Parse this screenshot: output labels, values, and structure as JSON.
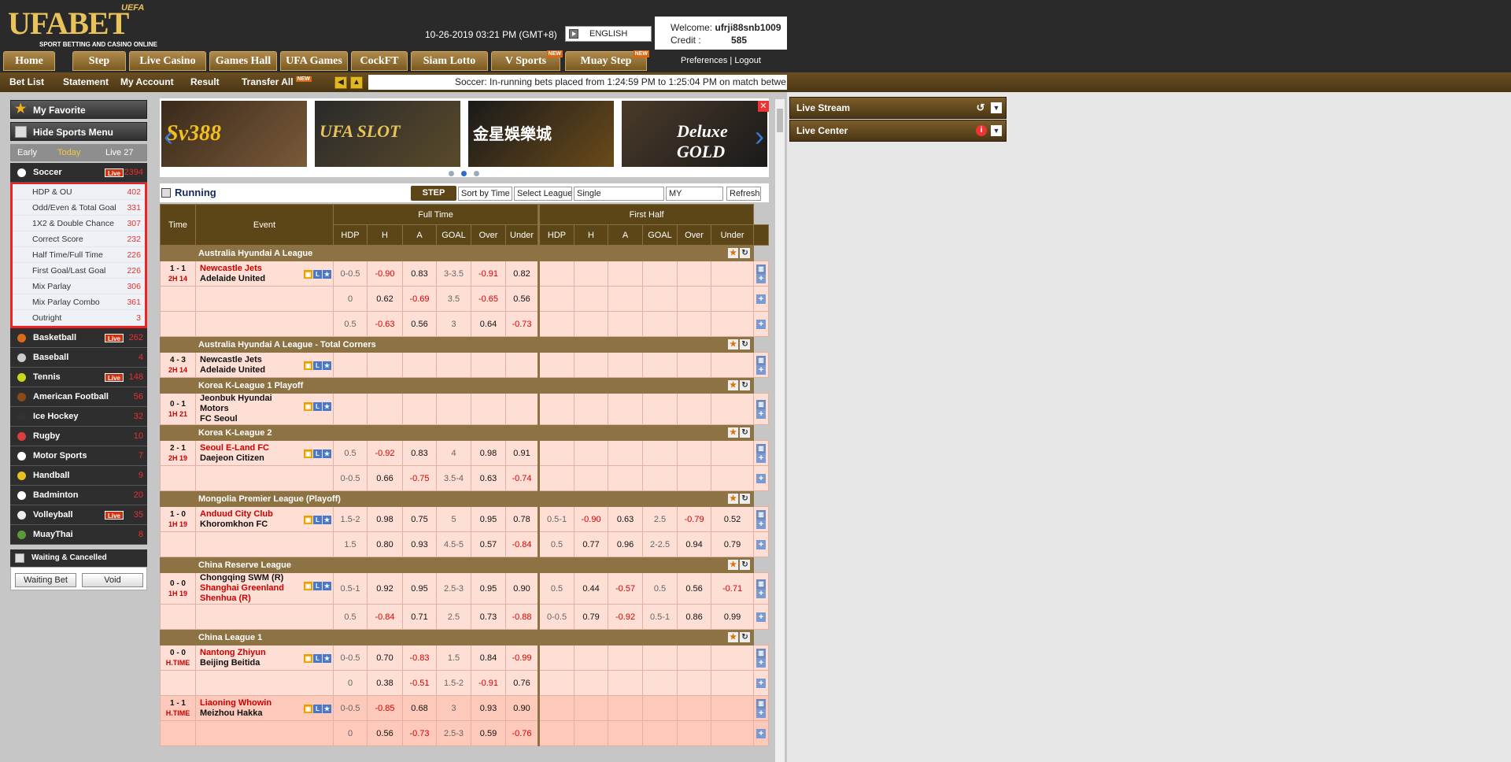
{
  "header": {
    "logo_uefa": "UEFA",
    "logo_main": "UFABET",
    "logo_sub": "SPORT BETTING AND CASINO ONLINE",
    "datetime": "10-26-2019 03:21 PM (GMT+8)",
    "language": "ENGLISH",
    "welcome_label": "Welcome:",
    "username": "ufrji88snb1009",
    "credit_label": "Credit :",
    "credit_value": "585",
    "preferences": "Preferences",
    "separator": "|",
    "logout": "Logout"
  },
  "topnav": [
    "Home",
    "Step",
    "Live Casino",
    "Games Hall",
    "UFA Games",
    "CockFT",
    "Siam Lotto",
    "V Sports",
    "Muay Step"
  ],
  "new_tag": "NEW",
  "subnav": {
    "items": [
      "Bet List",
      "Statement",
      "My Account",
      "Result",
      "Transfer All"
    ],
    "ticker": "Soccer: In-running bets placed from 1:24:59 PM to 1:25:04 PM on match betwe"
  },
  "sidebar": {
    "favorite": "My Favorite",
    "hide_menu": "Hide Sports Menu",
    "tabs": [
      "Early",
      "Today",
      "Live 27"
    ],
    "soccer": {
      "name": "Soccer",
      "live": "Live",
      "count": "2394"
    },
    "submenu": [
      {
        "label": "HDP & OU",
        "count": "402"
      },
      {
        "label": "Odd/Even & Total Goal",
        "count": "331"
      },
      {
        "label": "1X2 & Double Chance",
        "count": "307"
      },
      {
        "label": "Correct Score",
        "count": "232"
      },
      {
        "label": "Half Time/Full Time",
        "count": "226"
      },
      {
        "label": "First Goal/Last Goal",
        "count": "226"
      },
      {
        "label": "Mix Parlay",
        "count": "306"
      },
      {
        "label": "Mix Parlay Combo",
        "count": "361"
      },
      {
        "label": "Outright",
        "count": "3"
      }
    ],
    "sports": [
      {
        "name": "Basketball",
        "live": "Live",
        "count": "262",
        "color": "#d86b1a"
      },
      {
        "name": "Baseball",
        "live": "",
        "count": "4",
        "color": "#cccccc"
      },
      {
        "name": "Tennis",
        "live": "Live",
        "count": "148",
        "color": "#c8d820"
      },
      {
        "name": "American Football",
        "live": "",
        "count": "56",
        "color": "#8b4a1a"
      },
      {
        "name": "Ice Hockey",
        "live": "",
        "count": "32",
        "color": "#333333"
      },
      {
        "name": "Rugby",
        "live": "",
        "count": "10",
        "color": "#d84040"
      },
      {
        "name": "Motor Sports",
        "live": "",
        "count": "7",
        "color": "#ffffff"
      },
      {
        "name": "Handball",
        "live": "",
        "count": "9",
        "color": "#e8c020"
      },
      {
        "name": "Badminton",
        "live": "",
        "count": "20",
        "color": "#ffffff"
      },
      {
        "name": "Volleyball",
        "live": "Live",
        "count": "35",
        "color": "#eeeeee"
      },
      {
        "name": "MuayThai",
        "live": "",
        "count": "8",
        "color": "#5a9a3a"
      }
    ],
    "waiting": "Waiting & Cancelled",
    "waiting_bet": "Waiting Bet",
    "void": "Void"
  },
  "banners": [
    "Sv388",
    "UFA SLOT",
    "金星娛樂城",
    "Deluxe GOLD"
  ],
  "running": {
    "title": "Running",
    "step": "STEP",
    "sort": "Sort by Time",
    "league": "Select League",
    "type": "Single",
    "odds": "MY",
    "refresh": "Refresh"
  },
  "table": {
    "time": "Time",
    "event": "Event",
    "full_time": "Full Time",
    "first_half": "First Half",
    "cols": [
      "HDP",
      "H",
      "A",
      "GOAL",
      "Over",
      "Under"
    ],
    "rows": [
      {
        "type": "league",
        "name": "Australia Hyundai A League"
      },
      {
        "type": "match",
        "score": "1 - 1",
        "tm": "2H 14",
        "home": "Newcastle Jets",
        "away": "Adelaide United",
        "homeRed": true,
        "ft": [
          "0-0.5",
          "-0.90",
          "0.83",
          "3-3.5",
          "-0.91",
          "0.82"
        ],
        "fh": [
          "",
          "",
          "",
          "",
          "",
          ""
        ]
      },
      {
        "type": "sub",
        "ft": [
          "0",
          "0.62",
          "-0.69",
          "3.5",
          "-0.65",
          "0.56"
        ],
        "fh": [
          "",
          "",
          "",
          "",
          "",
          ""
        ]
      },
      {
        "type": "sub",
        "ft": [
          "0.5",
          "-0.63",
          "0.56",
          "3",
          "0.64",
          "-0.73"
        ],
        "fh": [
          "",
          "",
          "",
          "",
          "",
          ""
        ]
      },
      {
        "type": "league",
        "name": "Australia Hyundai A League - Total Corners"
      },
      {
        "type": "match",
        "score": "4 - 3",
        "tm": "2H 14",
        "home": "Newcastle Jets",
        "away": "Adelaide United",
        "homeRed": false,
        "ft": [
          "",
          "",
          "",
          "",
          "",
          ""
        ],
        "fh": [
          "",
          "",
          "",
          "",
          "",
          ""
        ]
      },
      {
        "type": "league",
        "name": "Korea K-League 1 Playoff"
      },
      {
        "type": "match",
        "score": "0 - 1",
        "tm": "1H 21",
        "home": "Jeonbuk Hyundai Motors",
        "away": "FC Seoul",
        "homeRed": false,
        "ft": [
          "",
          "",
          "",
          "",
          "",
          ""
        ],
        "fh": [
          "",
          "",
          "",
          "",
          "",
          ""
        ]
      },
      {
        "type": "league",
        "name": "Korea K-League 2"
      },
      {
        "type": "match",
        "score": "2 - 1",
        "tm": "2H 19",
        "home": "Seoul E-Land FC",
        "away": "Daejeon Citizen",
        "homeRed": true,
        "ft": [
          "0.5",
          "-0.92",
          "0.83",
          "4",
          "0.98",
          "0.91"
        ],
        "fh": [
          "",
          "",
          "",
          "",
          "",
          ""
        ]
      },
      {
        "type": "sub",
        "ft": [
          "0-0.5",
          "0.66",
          "-0.75",
          "3.5-4",
          "0.63",
          "-0.74"
        ],
        "fh": [
          "",
          "",
          "",
          "",
          "",
          ""
        ]
      },
      {
        "type": "league",
        "name": "Mongolia Premier League (Playoff)"
      },
      {
        "type": "match",
        "score": "1 - 0",
        "tm": "1H 19",
        "home": "Anduud City Club",
        "away": "Khoromkhon FC",
        "homeRed": true,
        "ft": [
          "1.5-2",
          "0.98",
          "0.75",
          "5",
          "0.95",
          "0.78"
        ],
        "fh": [
          "0.5-1",
          "-0.90",
          "0.63",
          "2.5",
          "-0.79",
          "0.52"
        ]
      },
      {
        "type": "sub",
        "ft": [
          "1.5",
          "0.80",
          "0.93",
          "4.5-5",
          "0.57",
          "-0.84"
        ],
        "fh": [
          "0.5",
          "0.77",
          "0.96",
          "2-2.5",
          "0.94",
          "0.79"
        ]
      },
      {
        "type": "league",
        "name": "China Reserve League"
      },
      {
        "type": "match",
        "score": "0 - 0",
        "tm": "1H 19",
        "home": "Chongqing SWM (R)",
        "away": "Shanghai Greenland Shenhua (R)",
        "homeRed": false,
        "awayRed": true,
        "ft": [
          "0.5-1",
          "0.92",
          "0.95",
          "2.5-3",
          "0.95",
          "0.90"
        ],
        "fh": [
          "0.5",
          "0.44",
          "-0.57",
          "0.5",
          "0.56",
          "-0.71"
        ]
      },
      {
        "type": "sub",
        "ft": [
          "0.5",
          "-0.84",
          "0.71",
          "2.5",
          "0.73",
          "-0.88"
        ],
        "fh": [
          "0-0.5",
          "0.79",
          "-0.92",
          "0.5-1",
          "0.86",
          "0.99"
        ]
      },
      {
        "type": "league",
        "name": "China League 1"
      },
      {
        "type": "match",
        "score": "0 - 0",
        "tm": "H.TIME",
        "home": "Nantong Zhiyun",
        "away": "Beijing Beitida",
        "homeRed": true,
        "ft": [
          "0-0.5",
          "0.70",
          "-0.83",
          "1.5",
          "0.84",
          "-0.99"
        ],
        "fh": [
          "",
          "",
          "",
          "",
          "",
          ""
        ]
      },
      {
        "type": "sub",
        "ft": [
          "0",
          "0.38",
          "-0.51",
          "1.5-2",
          "-0.91",
          "0.76"
        ],
        "fh": [
          "",
          "",
          "",
          "",
          "",
          ""
        ]
      },
      {
        "type": "match",
        "score": "1 - 1",
        "tm": "H.TIME",
        "home": "Liaoning Whowin",
        "away": "Meizhou Hakka",
        "homeRed": true,
        "ft": [
          "0-0.5",
          "-0.85",
          "0.68",
          "3",
          "0.93",
          "0.90"
        ],
        "fh": [
          "",
          "",
          "",
          "",
          "",
          ""
        ]
      },
      {
        "type": "sub",
        "ft": [
          "0",
          "0.56",
          "-0.73",
          "2.5-3",
          "0.59",
          "-0.76"
        ],
        "fh": [
          "",
          "",
          "",
          "",
          "",
          ""
        ]
      }
    ]
  },
  "live": {
    "stream": "Live Stream",
    "center": "Live Center"
  }
}
